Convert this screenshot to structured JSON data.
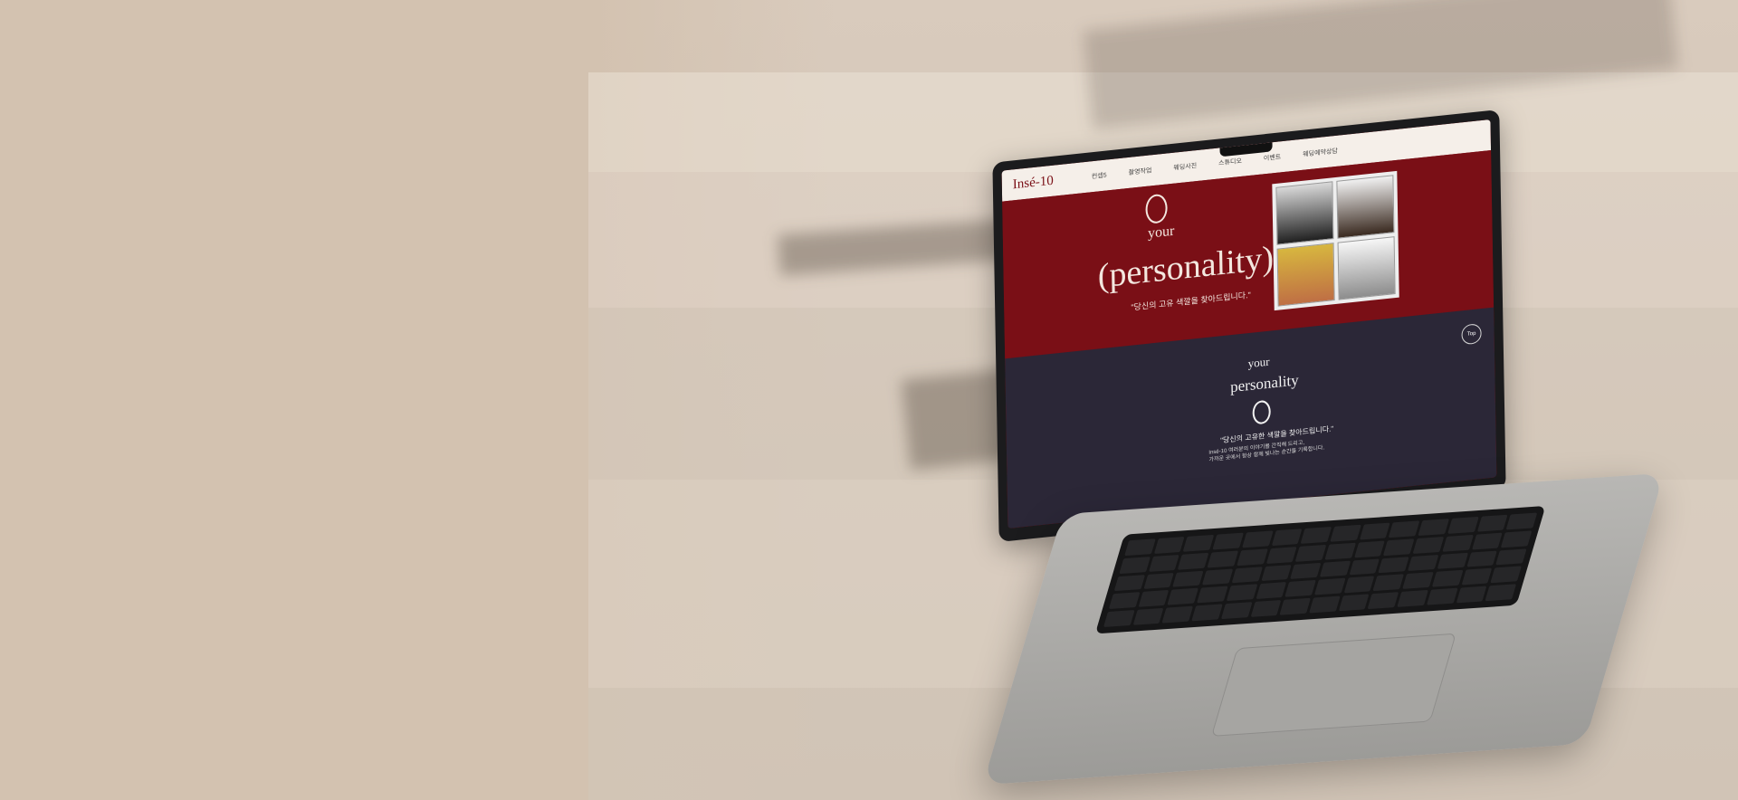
{
  "screen": {
    "logo_text": "Insé-10",
    "nav_items": [
      "컨셉5",
      "촬영작업",
      "웨딩사진",
      "스튜디오",
      "이벤트",
      "웨딩예약상담"
    ],
    "hero": {
      "small_title": "your",
      "large_title": "(personality)",
      "quote": "\"당신의 고유 색깔을 찾아드립니다.\""
    },
    "dark_section": {
      "small_title": "your",
      "large_title": "personality",
      "quote": "\"당신의 고유한 색깔을 찾아드립니다.\"",
      "copy_line_1": "Insé-10 여러분의 이야기를 간직해 드리고,",
      "copy_line_2": "가까운 곳에서 항상 함께 빛나는 순간을 기록합니다."
    },
    "top_button_label": "Top"
  }
}
